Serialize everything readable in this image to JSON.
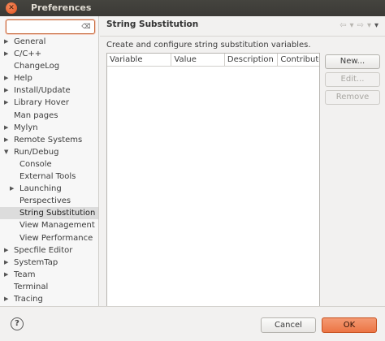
{
  "window": {
    "title": "Preferences",
    "close_glyph": "✕"
  },
  "filter": {
    "value": "",
    "placeholder": "",
    "clear_glyph": "⌫"
  },
  "tree": [
    {
      "label": "General",
      "arrow": "▶",
      "depth": 0
    },
    {
      "label": "C/C++",
      "arrow": "▶",
      "depth": 0
    },
    {
      "label": "ChangeLog",
      "arrow": "",
      "depth": 0
    },
    {
      "label": "Help",
      "arrow": "▶",
      "depth": 0
    },
    {
      "label": "Install/Update",
      "arrow": "▶",
      "depth": 0
    },
    {
      "label": "Library Hover",
      "arrow": "▶",
      "depth": 0
    },
    {
      "label": "Man pages",
      "arrow": "",
      "depth": 0
    },
    {
      "label": "Mylyn",
      "arrow": "▶",
      "depth": 0
    },
    {
      "label": "Remote Systems",
      "arrow": "▶",
      "depth": 0
    },
    {
      "label": "Run/Debug",
      "arrow": "▼",
      "depth": 0
    },
    {
      "label": "Console",
      "arrow": "",
      "depth": 1
    },
    {
      "label": "External Tools",
      "arrow": "",
      "depth": 1
    },
    {
      "label": "Launching",
      "arrow": "▶",
      "depth": 1
    },
    {
      "label": "Perspectives",
      "arrow": "",
      "depth": 1
    },
    {
      "label": "String Substitution",
      "arrow": "",
      "depth": 1,
      "selected": true
    },
    {
      "label": "View Management",
      "arrow": "",
      "depth": 1
    },
    {
      "label": "View Performance",
      "arrow": "",
      "depth": 1
    },
    {
      "label": "Specfile Editor",
      "arrow": "▶",
      "depth": 0
    },
    {
      "label": "SystemTap",
      "arrow": "▶",
      "depth": 0
    },
    {
      "label": "Team",
      "arrow": "▶",
      "depth": 0
    },
    {
      "label": "Terminal",
      "arrow": "",
      "depth": 0
    },
    {
      "label": "Tracing",
      "arrow": "▶",
      "depth": 0
    }
  ],
  "page": {
    "title": "String Substitution",
    "description": "Create and configure string substitution variables.",
    "nav": {
      "back": "⇦",
      "back_menu": "▾",
      "forward": "⇨",
      "forward_menu": "▾",
      "view_menu": "▾"
    }
  },
  "table": {
    "columns": [
      {
        "label": "Variable"
      },
      {
        "label": "Value"
      },
      {
        "label": "Description"
      },
      {
        "label": "Contribute"
      }
    ],
    "rows": []
  },
  "buttons": {
    "new": "New...",
    "edit": "Edit...",
    "remove": "Remove"
  },
  "footer": {
    "help": "?",
    "cancel": "Cancel",
    "ok": "OK"
  }
}
